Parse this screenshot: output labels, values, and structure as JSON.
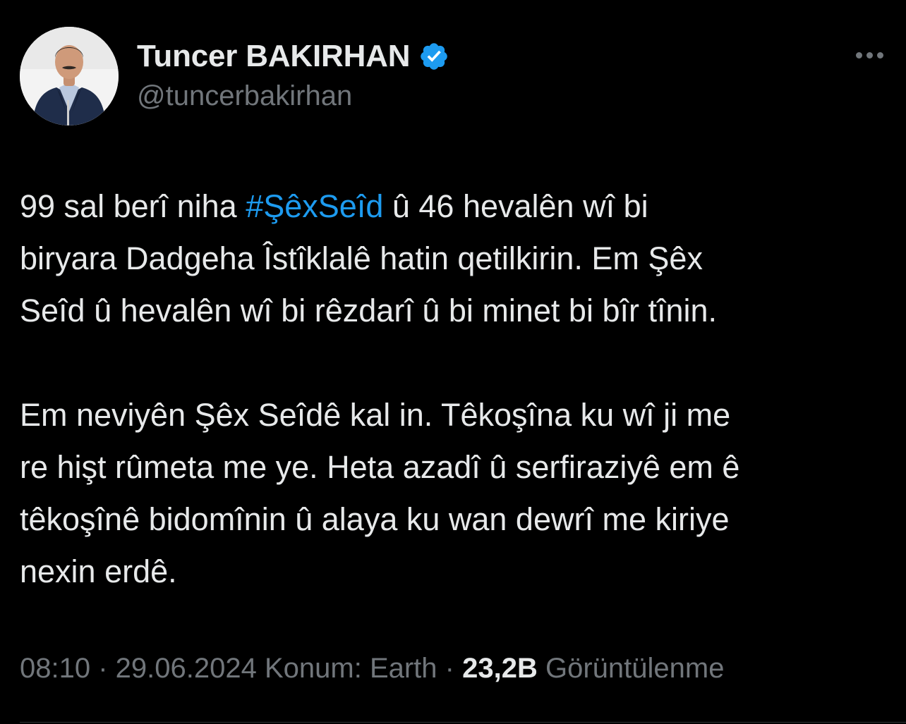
{
  "colors": {
    "background": "#000000",
    "text_primary": "#e7e9ea",
    "text_secondary": "#71767b",
    "accent_link": "#1d9bf0",
    "verified_badge": "#1d9bf0",
    "divider": "#2f3336"
  },
  "author": {
    "display_name": "Tuncer BAKIRHAN",
    "handle": "@tuncerbakirhan",
    "verified_icon": "verified-badge-icon",
    "avatar_icon": "profile-photo"
  },
  "menu": {
    "more_icon": "more-horizontal-icon"
  },
  "tweet": {
    "line1_before": "99 sal berî niha ",
    "hashtag": "#ŞêxSeîd",
    "line1_after": " û 46 hevalên wî bi",
    "line2": "biryara Dadgeha Îstîklalê hatin qetilkirin. Em Şêx",
    "line3": "Seîd û hevalên wî bi rêzdarî û bi minet bi bîr tînin.",
    "line4": "Em neviyên Şêx Seîdê kal in. Têkoşîna ku wî ji me",
    "line5": "re hişt rûmeta me ye. Heta azadî û serfiraziyê em ê",
    "line6": "têkoşînê bidomînin û alaya ku wan dewrî me kiriye",
    "line7": "nexin erdê."
  },
  "meta": {
    "time": "08:10",
    "separator": " · ",
    "date": "29.06.2024",
    "location": " Konum: Earth",
    "views_count": "23,2B",
    "views_label": " Görüntülenme"
  }
}
